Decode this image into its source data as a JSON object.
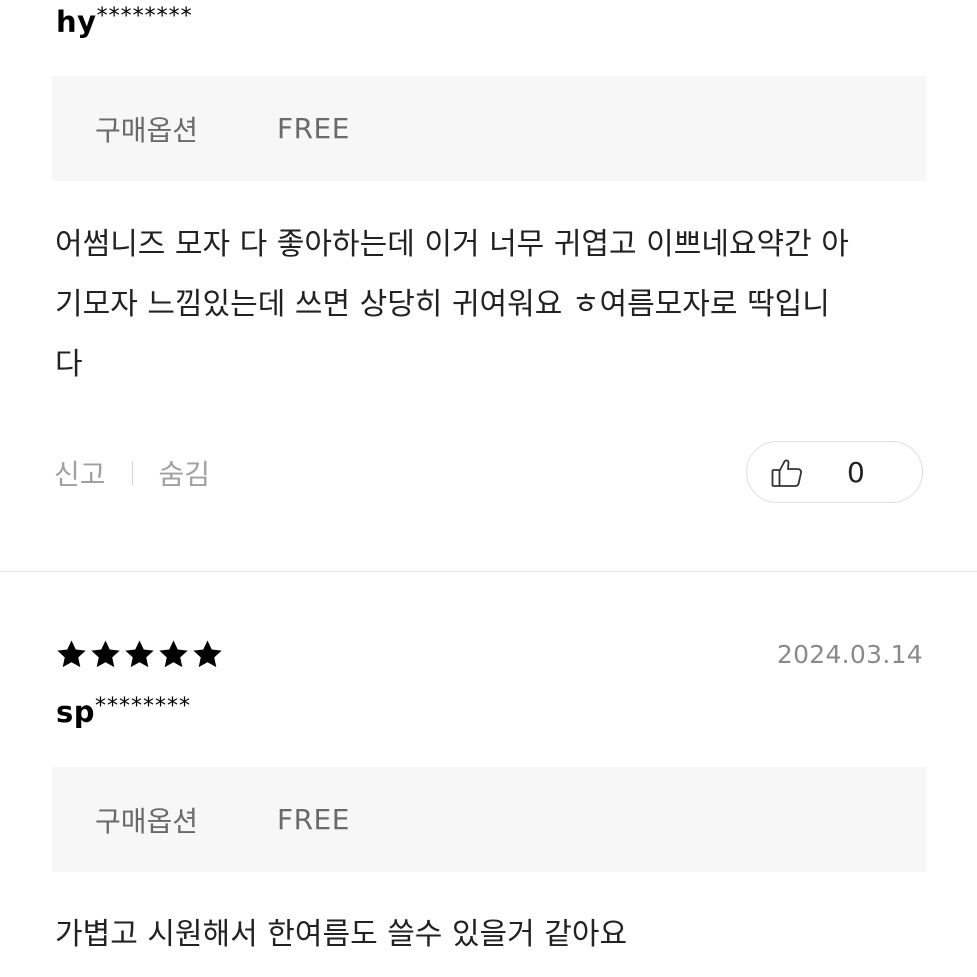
{
  "reviews": [
    {
      "user_prefix": "hy",
      "user_mask": "********",
      "option_label": "구매옵션",
      "option_value": "FREE",
      "text_lines": [
        "어썸니즈 모자 다 좋아하는데 이거 너무 귀엽고 이쁘네요약간 아",
        "기모자 느낌있는데 쓰면 상당히 귀여워요 ㅎ여름모자로 딱입니",
        "다"
      ],
      "report_label": "신고",
      "hide_label": "숨김",
      "like_count": "0",
      "like_icon": "thumbs-up-icon"
    },
    {
      "rating": 5,
      "star_icon": "star-icon",
      "date": "2024.03.14",
      "user_prefix": "sp",
      "user_mask": "********",
      "option_label": "구매옵션",
      "option_value": "FREE",
      "text_lines": [
        "가볍고 시원해서 한여름도 쓸수 있을거 같아요"
      ]
    }
  ],
  "colors": {
    "star": "#000000",
    "muted_text": "#8a8a8a",
    "option_bg": "#f7f7f7",
    "divider": "#e3e3e3"
  }
}
